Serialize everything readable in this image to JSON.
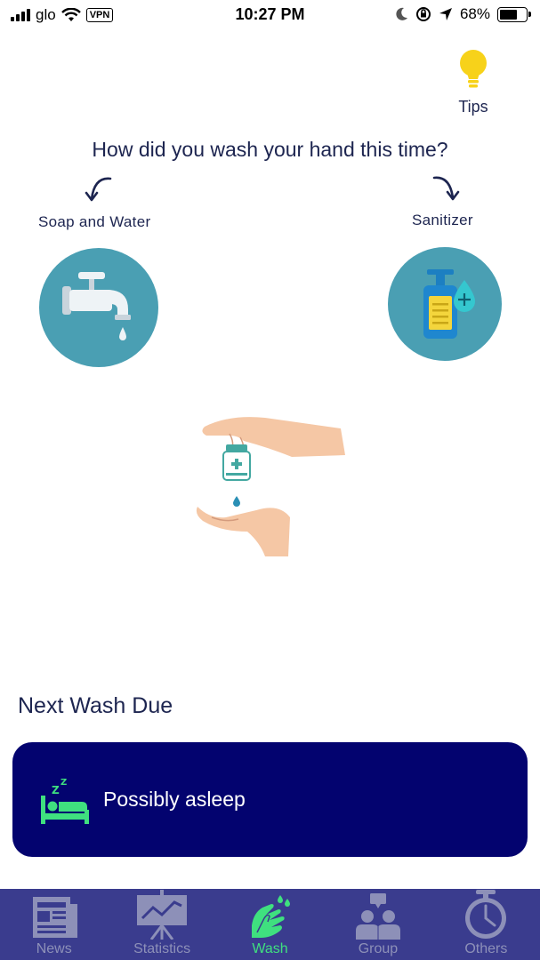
{
  "status_bar": {
    "carrier": "glo",
    "vpn": "VPN",
    "time": "10:27 PM",
    "battery": "68%",
    "battery_level": 0.68
  },
  "tips": {
    "label": "Tips",
    "icon": "lightbulb-icon"
  },
  "question": "How did you wash your hand this time?",
  "options": {
    "soap": {
      "label": "Soap and Water",
      "icon": "faucet-icon"
    },
    "sanitizer": {
      "label": "Sanitizer",
      "icon": "sanitizer-bottle-icon"
    }
  },
  "next_wash": {
    "title": "Next Wash Due",
    "status": "Possibly asleep",
    "icon": "sleeping-bed-icon"
  },
  "tabs": [
    {
      "label": "News",
      "icon": "newspaper-icon",
      "active": false
    },
    {
      "label": "Statistics",
      "icon": "chart-board-icon",
      "active": false
    },
    {
      "label": "Wash",
      "icon": "hands-wash-icon",
      "active": true
    },
    {
      "label": "Group",
      "icon": "group-icon",
      "active": false
    },
    {
      "label": "Others",
      "icon": "clock-icon",
      "active": false
    }
  ],
  "colors": {
    "accent": "#3fe07f",
    "card": "#03036f",
    "tab_bar": "#3a3c8e",
    "circle": "#4a9fb3",
    "text": "#1d2550"
  }
}
